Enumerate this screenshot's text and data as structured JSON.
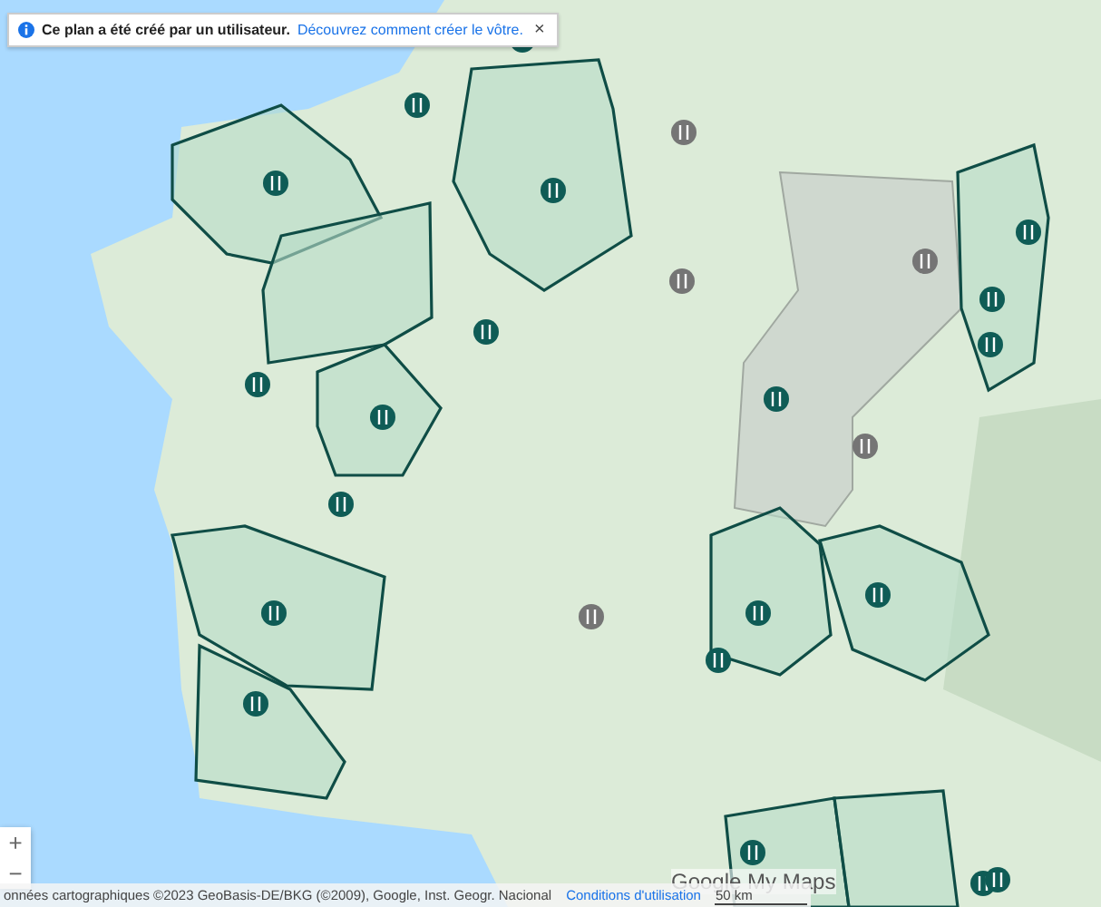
{
  "banner": {
    "text": "Ce plan a été créé par un utilisateur.",
    "link": "Découvrez comment créer le vôtre.",
    "close": "×"
  },
  "zoom": {
    "in": "+",
    "out": "−"
  },
  "logo": {
    "text": "Google My Maps"
  },
  "footer": {
    "attribution": "onnées cartographiques ©2023 GeoBasis-DE/BKG (©2009), Google, Inst. Geogr. Nacional",
    "terms": "Conditions d'utilisation",
    "scale": "50 km"
  }
}
